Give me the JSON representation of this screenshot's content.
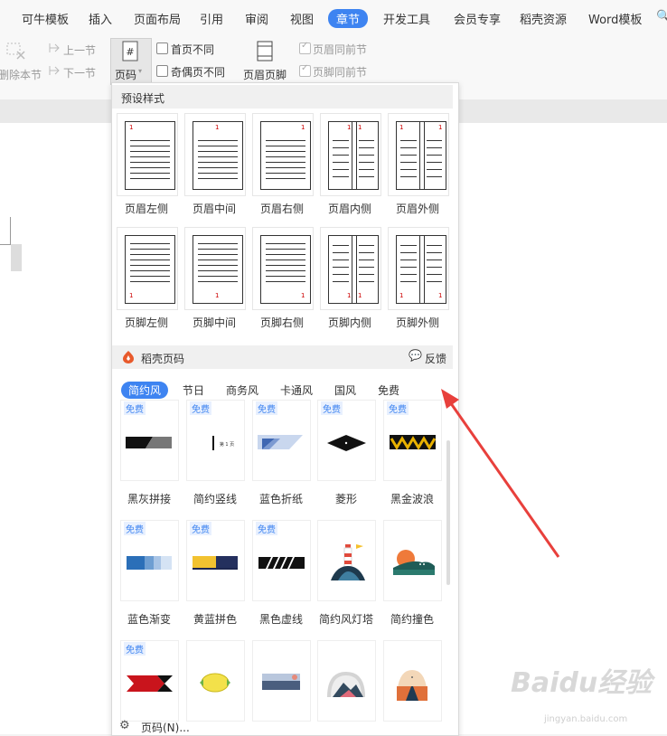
{
  "menubar": {
    "tabs": [
      "可牛模板",
      "插入",
      "页面布局",
      "引用",
      "审阅",
      "视图",
      "章节",
      "开发工具",
      "会员专享",
      "稻壳资源",
      "Word模板"
    ],
    "active": "章节"
  },
  "ribbon": {
    "delete_section": "删除本节",
    "prev_section": "上一节",
    "next_section": "下一节",
    "page_number": "页码",
    "first_page_diff": "首页不同",
    "odd_even_diff": "奇偶页不同",
    "header_footer": "页眉页脚",
    "header_same_prev": "页眉同前节",
    "footer_same_prev": "页脚同前节"
  },
  "dropdown": {
    "presets_title": "预设样式",
    "header_presets": [
      "页眉左侧",
      "页眉中间",
      "页眉右侧",
      "页眉内侧",
      "页眉外侧"
    ],
    "footer_presets": [
      "页脚左侧",
      "页脚中间",
      "页脚右侧",
      "页脚内侧",
      "页脚外侧"
    ],
    "page_num_sample": "1",
    "docer_title": "稻壳页码",
    "feedback": "反馈",
    "style_tabs": [
      "简约风",
      "节日",
      "商务风",
      "卡通风",
      "国风",
      "免费"
    ],
    "active_style": "简约风",
    "free_badge": "免费",
    "row1": [
      "黑灰拼接",
      "简约竖线",
      "蓝色折纸",
      "菱形",
      "黑金波浪"
    ],
    "row2": [
      "蓝色渐变",
      "黄蓝拼色",
      "黑色虚线",
      "简约风灯塔",
      "简约撞色"
    ],
    "sample_text": "第 1 页",
    "footer_link": "页码(N)..."
  },
  "watermark": {
    "brand": "Baidu经验",
    "url": "jingyan.baidu.com"
  },
  "colors": {
    "accent": "#3e84f1",
    "arrow": "#e8403c"
  }
}
